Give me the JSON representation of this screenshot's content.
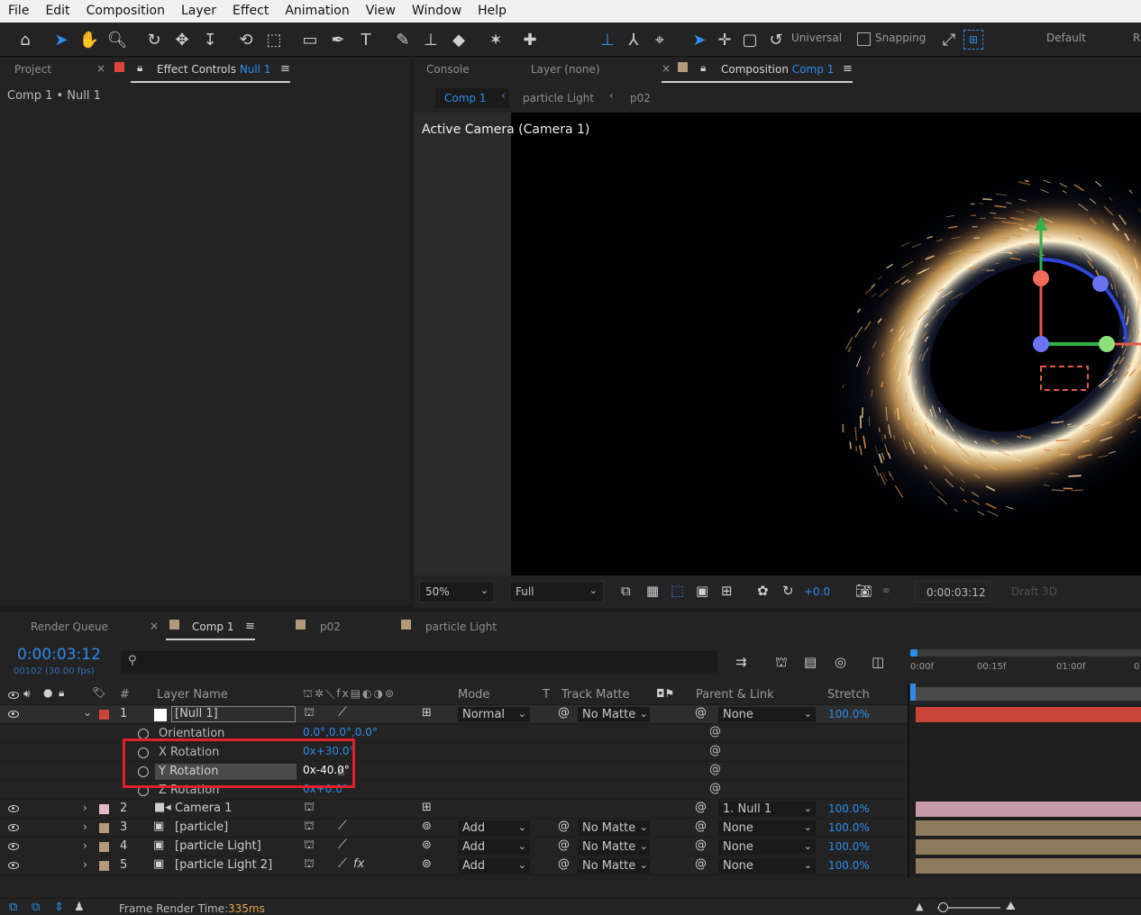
{
  "menu": [
    "File",
    "Edit",
    "Composition",
    "Layer",
    "Effect",
    "Animation",
    "View",
    "Window",
    "Help"
  ],
  "toolbar": {
    "axis_mode": "Universal",
    "snapping": "Snapping",
    "workspace": "Default",
    "workspace_cut": "R"
  },
  "left_panel": {
    "tab_project": "Project",
    "tab_effect_controls": "Effect Controls",
    "effect_target": "Null 1",
    "breadcrumb": "Comp 1 • Null 1"
  },
  "right_panel": {
    "tab_console": "Console",
    "tab_layer": "Layer (none)",
    "tab_composition": "Composition",
    "comp_target": "Comp 1",
    "subtabs": [
      "Comp 1",
      "particle Light",
      "p02"
    ],
    "viewer_label": "Active Camera (Camera 1)"
  },
  "viewer_footer": {
    "zoom": "50%",
    "resolution": "Full",
    "exposure": "+0.0",
    "timecode": "0:00:03:12",
    "draft": "Draft 3D"
  },
  "timeline": {
    "tab_render_queue": "Render Queue",
    "tab_comp": "Comp 1",
    "tab_p02": "p02",
    "tab_particle_light": "particle Light",
    "current_time": "0:00:03:12",
    "frame_info": "00102 (30.00 fps)",
    "search_placeholder": "",
    "ruler": [
      "0:00f",
      "00:15f",
      "01:00f",
      "0"
    ],
    "headers": {
      "num": "#",
      "layer_name": "Layer Name",
      "mode": "Mode",
      "t": "T",
      "track_matte": "Track Matte",
      "parent": "Parent & Link",
      "stretch": "Stretch"
    },
    "layers": [
      {
        "num": "1",
        "name": "[Null 1]",
        "mode": "Normal",
        "matte": "No Matte",
        "parent": "None",
        "stretch": "100.0%",
        "color": "#c9453a"
      },
      {
        "num": "2",
        "name": "Camera 1",
        "mode": "",
        "matte": "",
        "parent": "1. Null 1",
        "stretch": "100.0%",
        "color": "#e7b9c6"
      },
      {
        "num": "3",
        "name": "[particle]",
        "mode": "Add",
        "matte": "No Matte",
        "parent": "None",
        "stretch": "100.0%",
        "color": "#b49a7a"
      },
      {
        "num": "4",
        "name": "[particle Light]",
        "mode": "Add",
        "matte": "No Matte",
        "parent": "None",
        "stretch": "100.0%",
        "color": "#b49a7a"
      },
      {
        "num": "5",
        "name": "[particle Light 2]",
        "mode": "Add",
        "matte": "No Matte",
        "parent": "None",
        "stretch": "100.0%",
        "color": "#b49a7a"
      }
    ],
    "properties": [
      {
        "name": "Orientation",
        "value": "0.0°,0.0°,0.0°"
      },
      {
        "name": "X Rotation",
        "value": "0x+30.0°"
      },
      {
        "name": "Y Rotation",
        "value": "0x-40.0°"
      },
      {
        "name": "Z Rotation",
        "value": "0x+0.0°"
      }
    ],
    "footer_label": "Frame Render Time:",
    "footer_value": "335ms"
  },
  "colors": {
    "accent": "#2d8ceb",
    "highlight_box": "#e0202b",
    "null_track": "#c9453a",
    "camera_track": "#c69aa8",
    "particle_track": "#8e7a5d"
  }
}
